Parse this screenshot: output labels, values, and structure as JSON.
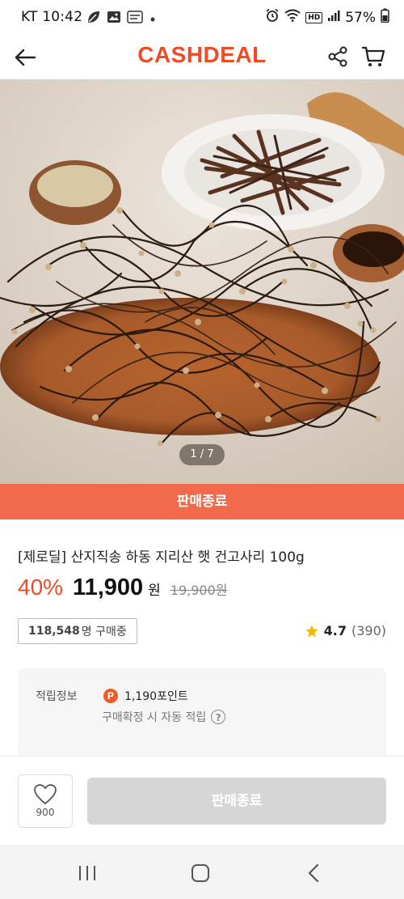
{
  "status_bar": {
    "carrier_time": "KT 10:42",
    "battery": "57%",
    "icons_left": [
      "leaf-icon",
      "image-icon",
      "memo-icon",
      "dot-icon"
    ],
    "icons_right": [
      "alarm-icon",
      "wifi-icon",
      "hd-icon",
      "signal-icon",
      "battery-icon"
    ],
    "hd_label": "HD"
  },
  "header": {
    "logo": "CASHDEAL",
    "brand_color": "#ef4b26"
  },
  "gallery": {
    "counter": "1 / 7"
  },
  "banner": {
    "label": "판매종료",
    "color": "#f06a4b"
  },
  "product": {
    "title": "[제로딜] 산지직송 하동 지리산 햇 건고사리 100g",
    "discount": "40%",
    "price": "11,900",
    "currency": "원",
    "original_price": "19,900원",
    "buyers_count": "118,548",
    "buyers_suffix": "명 구매중",
    "rating": "4.7",
    "review_count": "(390)"
  },
  "points": {
    "label": "적립정보",
    "icon_letter": "P",
    "amount": "1,190포인트",
    "note": "구매확정 시 자동 적립",
    "help": "?"
  },
  "bottom_bar": {
    "like_count": "900",
    "buy_label": "판매종료"
  },
  "nav": {
    "items": [
      "recent-apps-icon",
      "home-icon",
      "back-icon"
    ]
  }
}
